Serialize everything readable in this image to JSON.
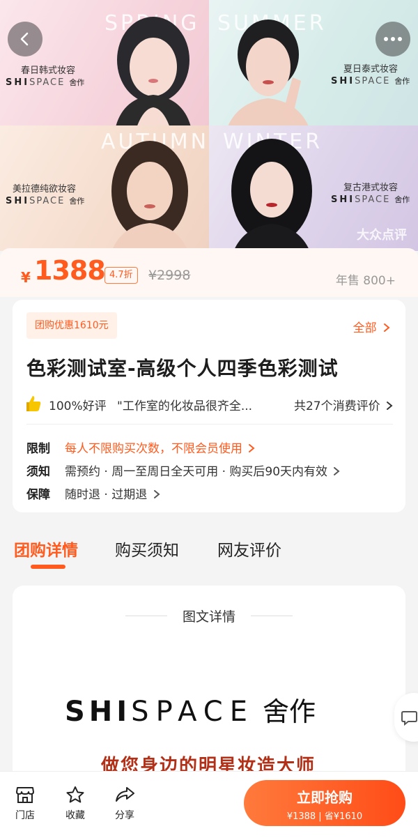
{
  "hero": {
    "panels": [
      {
        "season": "SPRING",
        "style": "春日韩式妆容"
      },
      {
        "season": "SUMMER",
        "style": "夏日泰式妆容"
      },
      {
        "season": "AUTUMN",
        "style": "美拉德纯欲妆容"
      },
      {
        "season": "WINTER",
        "style": "复古港式妆容"
      }
    ],
    "brand_bold": "SHI",
    "brand_light": "SPACE",
    "brand_cn": "舍作",
    "watermark": "大众点评"
  },
  "price": {
    "currency": "¥",
    "value": "1388",
    "discount": "4.7折",
    "original": "¥2998",
    "annual_sales": "年售 800+"
  },
  "info": {
    "promo_tag": "团购优惠1610元",
    "all_link": "全部",
    "title": "色彩测试室-高级个人四季色彩测试",
    "good_rate": "100%好评",
    "review_quote": "\"工作室的化妆品很齐全...",
    "review_count": "共27个消费评价",
    "rules": [
      {
        "label": "限制",
        "text": "每人不限购买次数，不限会员使用"
      },
      {
        "label": "须知",
        "text": "需预约 · 周一至周日全天可用 · 购买后90天内有效"
      },
      {
        "label": "保障",
        "text": "随时退 · 过期退"
      }
    ]
  },
  "tabs": [
    "团购详情",
    "购买须知",
    "网友评价"
  ],
  "detail": {
    "title": "图文详情",
    "brand_bold": "SHI",
    "brand_light": "SPACE",
    "brand_cn": "舍作",
    "slogan": "做您身边的明星妆造大师"
  },
  "bottom_bar": {
    "store": "门店",
    "favorite": "收藏",
    "share": "分享",
    "buy_label": "立即抢购",
    "buy_sub": "¥1388 | 省¥1610"
  },
  "colors": {
    "accent": "#ff5b1f",
    "slogan": "#b23017"
  }
}
